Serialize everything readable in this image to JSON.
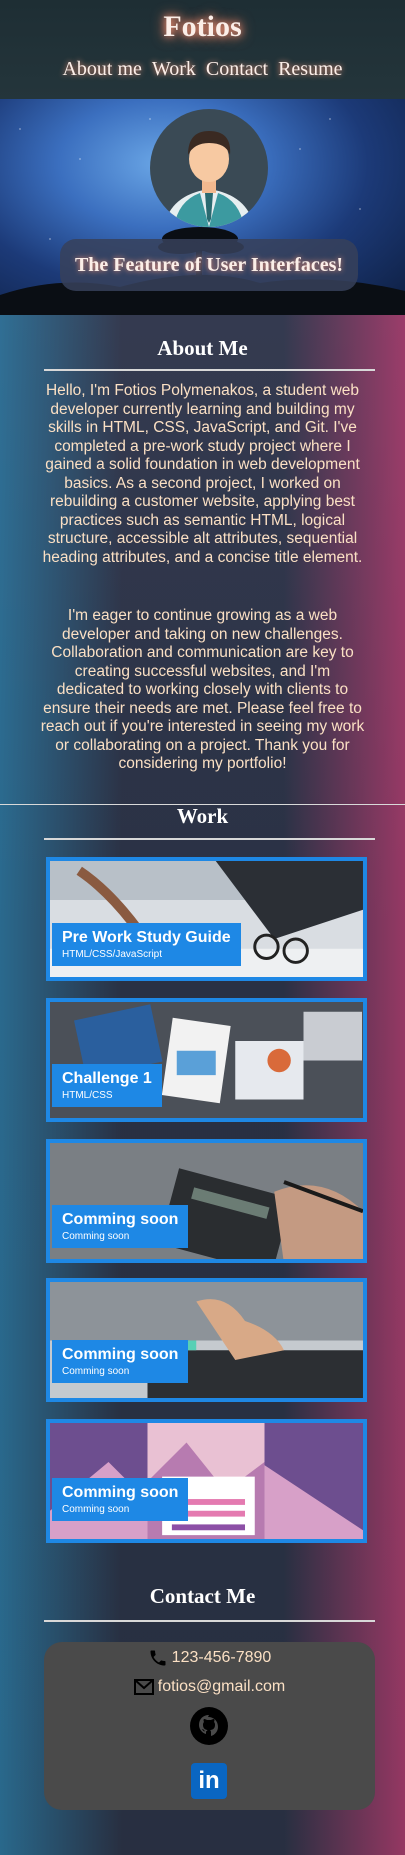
{
  "header": {
    "site_title": "Fotios",
    "nav": [
      "About me",
      "Work",
      "Contact",
      "Resume"
    ]
  },
  "hero": {
    "tagline": "The Feature of User Interfaces!"
  },
  "about": {
    "title": "About Me",
    "paragraph1": "Hello, I'm Fotios Polymenakos, a student web developer currently learning and building my skills in HTML, CSS, JavaScript, and Git. I've completed a pre-work study project where I gained a solid foundation in web development basics. As a second project, I worked on rebuilding a customer website, applying best practices such as semantic HTML, logical structure, accessible alt attributes, sequential heading attributes, and a concise title element.",
    "paragraph2": "I'm eager to continue growing as a web developer and taking on new challenges. Collaboration and communication are key to creating successful websites, and I'm dedicated to working closely with clients to ensure their needs are met. Please feel free to reach out if you're interested in seeing my work or collaborating on a project. Thank you for considering my portfolio!"
  },
  "work": {
    "title": "Work",
    "cards": [
      {
        "title": "Pre Work Study Guide",
        "subtitle": "HTML/CSS/JavaScript",
        "image": "desk-with-glasses"
      },
      {
        "title": "Challenge 1",
        "subtitle": "HTML/CSS",
        "image": "laptop-with-charts"
      },
      {
        "title": "Comming soon",
        "subtitle": "Comming soon",
        "image": "calculator-and-pen"
      },
      {
        "title": "Comming soon",
        "subtitle": "Comming soon",
        "image": "keyboard-thumbs-up"
      },
      {
        "title": "Comming soon",
        "subtitle": "Comming soon",
        "image": "login-page-mockup"
      }
    ]
  },
  "contact": {
    "title": "Contact Me",
    "phone": "123-456-7890",
    "email": "fotios@gmail.com",
    "icons": [
      "phone-icon",
      "mail-icon",
      "github-icon",
      "linkedin-icon"
    ],
    "linkedin_text": "in"
  },
  "colors": {
    "accent": "#1e88e5",
    "text_warm": "#fbe0c4",
    "contact_box": "#4a4a4a"
  }
}
